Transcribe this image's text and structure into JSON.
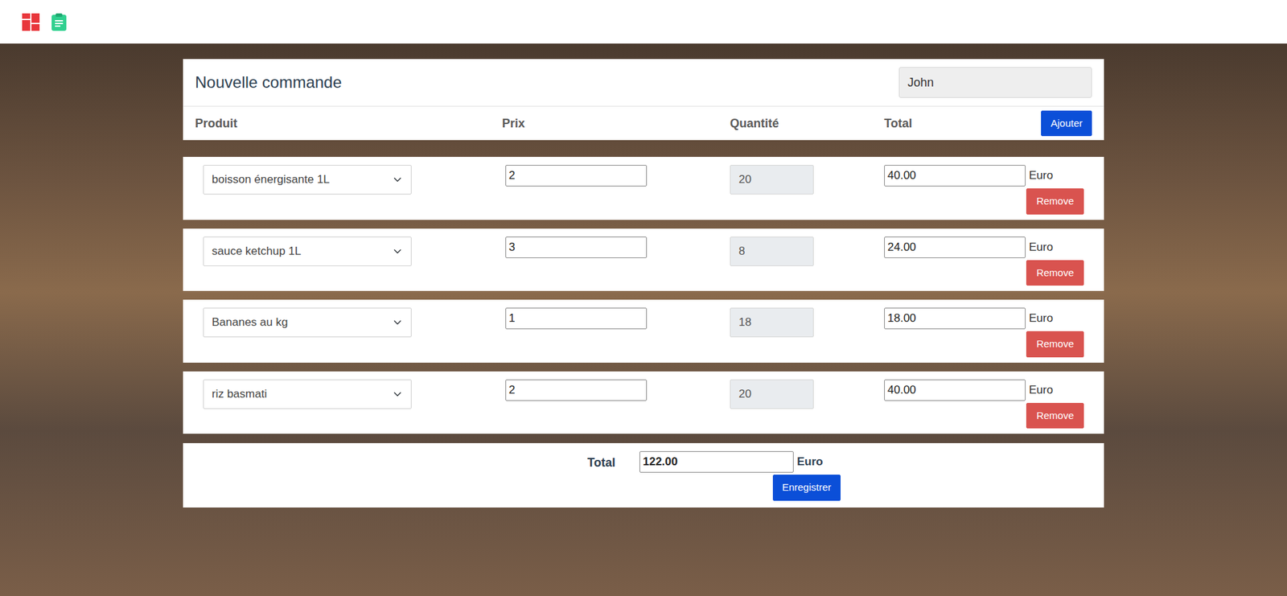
{
  "header": {
    "title": "Nouvelle commande",
    "client": "John"
  },
  "columns": [
    "Produit",
    "Prix",
    "Quantité",
    "Total"
  ],
  "add_button": "Ajouter",
  "rows": [
    {
      "product": "boisson énergisante 1L",
      "price": "2",
      "quantity": "20",
      "total": "40.00",
      "currency": "Euro",
      "remove": "Remove"
    },
    {
      "product": "sauce ketchup 1L",
      "price": "3",
      "quantity": "8",
      "total": "24.00",
      "currency": "Euro",
      "remove": "Remove"
    },
    {
      "product": "Bananes au kg",
      "price": "1",
      "quantity": "18",
      "total": "18.00",
      "currency": "Euro",
      "remove": "Remove"
    },
    {
      "product": "riz basmati",
      "price": "2",
      "quantity": "20",
      "total": "40.00",
      "currency": "Euro",
      "remove": "Remove"
    }
  ],
  "footer": {
    "label": "Total",
    "total": "122.00",
    "currency": "Euro",
    "save": "Enregistrer"
  }
}
